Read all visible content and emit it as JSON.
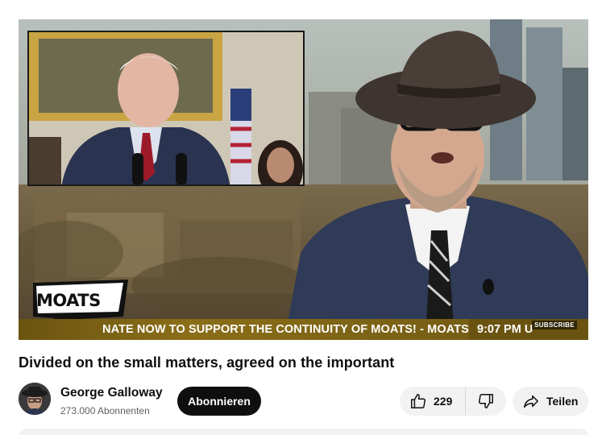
{
  "video": {
    "title": "Divided on the small matters, agreed on the important",
    "ticker_text": "NATE NOW TO SUPPORT THE CONTINUITY OF MOATS! - MOATS.T",
    "ticker_time": "9:07 PM U",
    "overlay_subscribe": "SUBSCRIBE",
    "logo_text": "MOATS"
  },
  "channel": {
    "name": "George Galloway",
    "subscribers": "273.000 Abonnenten",
    "subscribe_label": "Abonnieren"
  },
  "actions": {
    "like_count": "229",
    "share_label": "Teilen"
  },
  "colors": {
    "ticker_bg": "#6b5410",
    "subscribe_bg": "#0f0f0f",
    "pill_bg": "#f2f2f2"
  },
  "icons": {
    "like": "thumbs-up-icon",
    "dislike": "thumbs-down-icon",
    "share": "share-arrow-icon"
  }
}
